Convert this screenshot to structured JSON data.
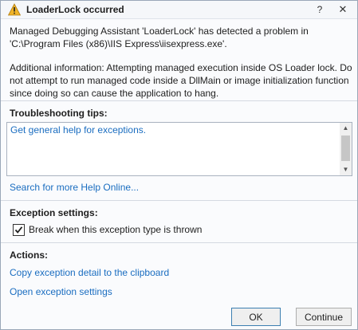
{
  "dialog": {
    "title": "LoaderLock occurred",
    "help_glyph": "?",
    "close_glyph": "✕",
    "icon": "warning-icon",
    "colors": {
      "warning": "#f0b429",
      "link": "#1a6dc0",
      "accent": "#3c7fb1"
    }
  },
  "message": {
    "line1": "Managed Debugging Assistant 'LoaderLock' has detected a problem in 'C:\\Program Files (x86)\\IIS Express\\iisexpress.exe'.",
    "line2": "Additional information: Attempting managed execution inside OS Loader lock. Do not attempt to run managed code inside a DllMain or image initialization function since doing so can cause the application to hang."
  },
  "troubleshooting": {
    "label": "Troubleshooting tips:",
    "tip": "Get general help for exceptions.",
    "search_link": "Search for more Help Online..."
  },
  "exception_settings": {
    "label": "Exception settings:",
    "break_label": "Break when this exception type is thrown",
    "break_checked": true
  },
  "actions": {
    "label": "Actions:",
    "copy_link": "Copy exception detail to the clipboard",
    "open_link": "Open exception settings"
  },
  "buttons": {
    "ok": "OK",
    "continue": "Continue"
  }
}
